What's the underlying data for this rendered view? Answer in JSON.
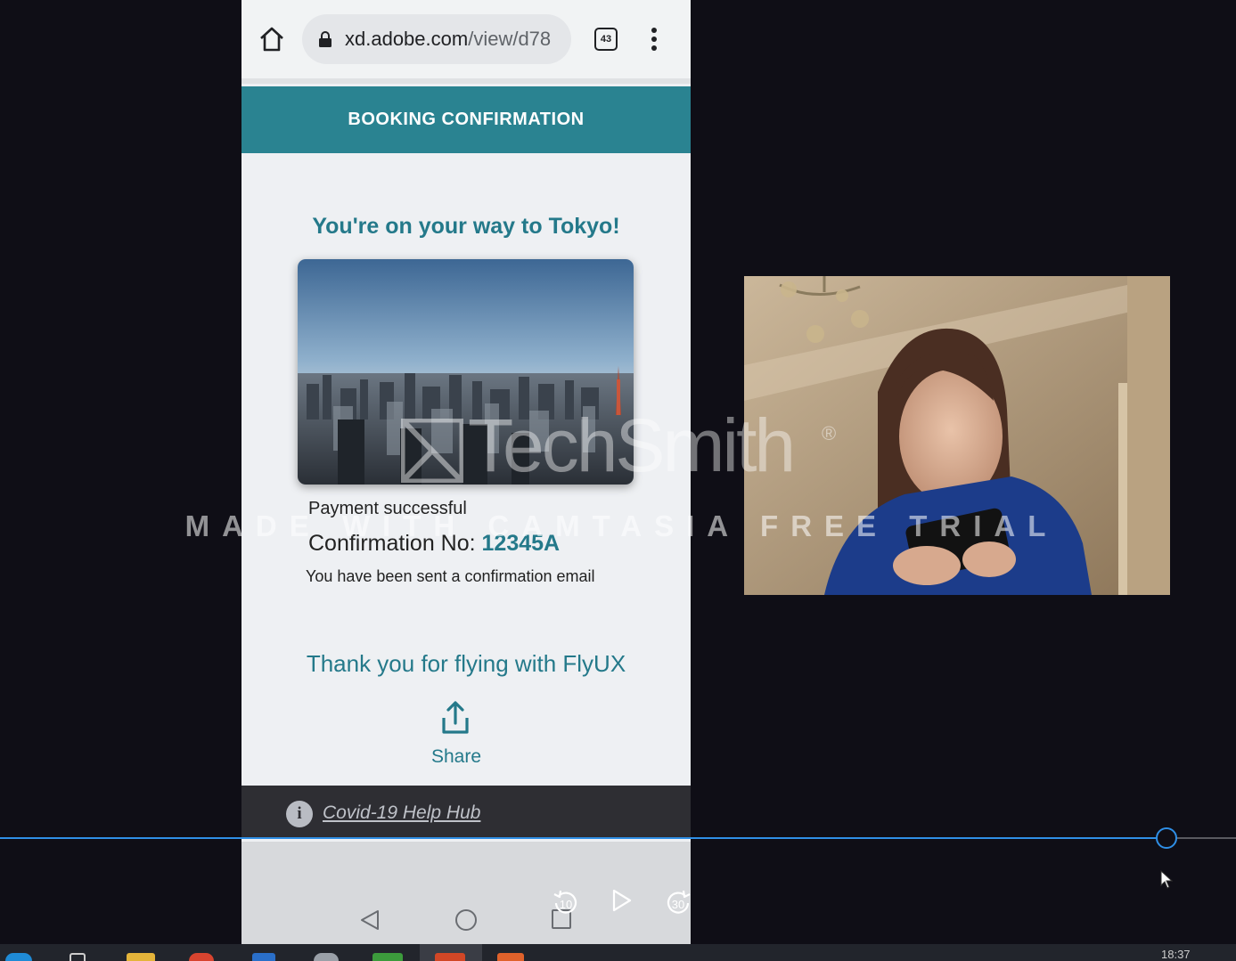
{
  "browser": {
    "url_domain": "xd.adobe.com",
    "url_path": "/view/d78",
    "tab_count": "43"
  },
  "app": {
    "header_title": "BOOKING CONFIRMATION",
    "headline": "You're on your way to Tokyo!",
    "payment_status": "Payment successful",
    "confirmation_label": "Confirmation No: ",
    "confirmation_number": "12345A",
    "email_note": "You have been sent a confirmation email",
    "thanks": "Thank you for flying with FlyUX",
    "share_label": "Share",
    "covid_link": "Covid-19 Help Hub"
  },
  "watermark": {
    "brand": "TechSmith",
    "reg_mark": "®",
    "trial_text": "MADE WITH CAMTASIA FREE TRIAL"
  },
  "player": {
    "progress": 0.944,
    "skip_back_seconds": "10",
    "skip_forward_seconds": "30"
  },
  "taskbar": {
    "clock": "18:37"
  },
  "colors": {
    "brand_teal": "#2a8391",
    "text_teal": "#24798a",
    "progress_blue": "#2f8fe6"
  },
  "icons": [
    "home-icon",
    "lock-icon",
    "tabs-icon",
    "menu-icon",
    "share-icon",
    "info-icon",
    "back-icon",
    "home-circle-icon",
    "recents-icon",
    "skip-back-icon",
    "play-icon",
    "skip-forward-icon",
    "cursor-icon"
  ]
}
